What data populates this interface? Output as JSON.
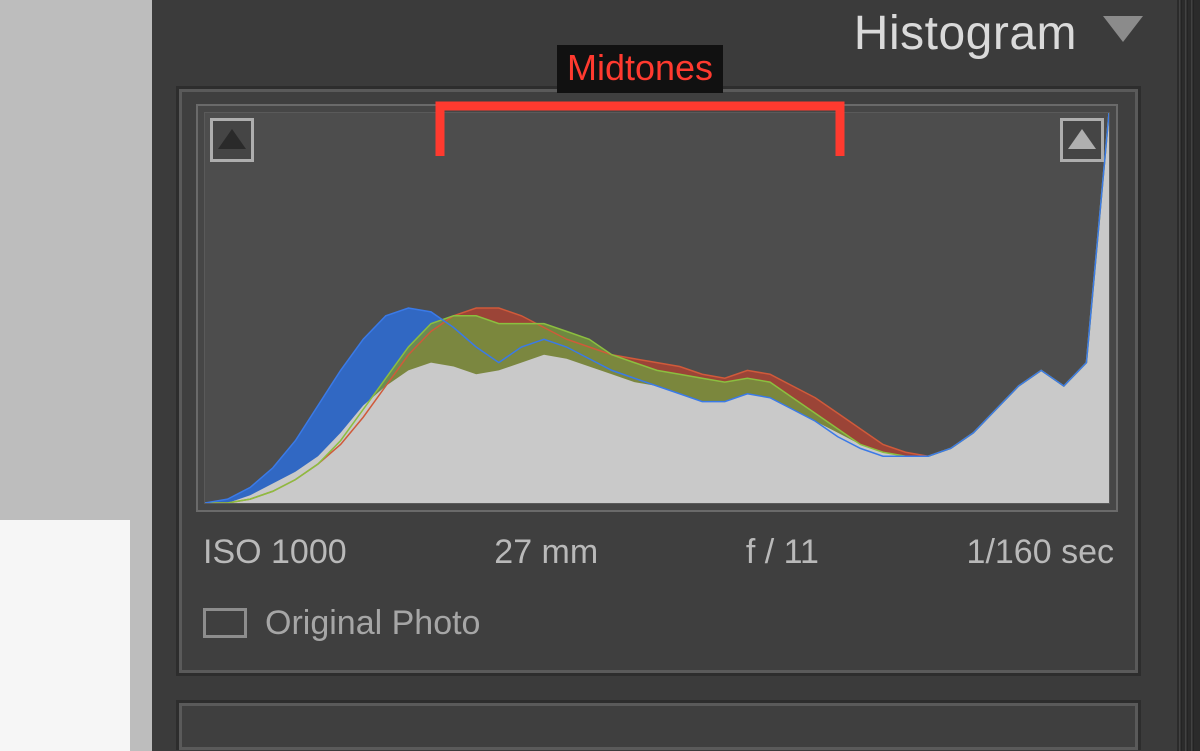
{
  "panel": {
    "title": "Histogram"
  },
  "annotation": {
    "label": "Midtones"
  },
  "meta": {
    "iso": "ISO 1000",
    "focal": "27 mm",
    "aperture": "f / 11",
    "shutter": "1/160 sec"
  },
  "original": {
    "label": "Original Photo",
    "checked": false
  },
  "clipping": {
    "shadows_enabled": false,
    "highlights_enabled": false
  },
  "chart_data": {
    "type": "area",
    "title": "Histogram",
    "xlabel": "",
    "ylabel": "",
    "xlim": [
      0,
      255
    ],
    "ylim": [
      0,
      100
    ],
    "series": [
      {
        "name": "Luminance",
        "color": "#c9c9c9",
        "values": [
          0,
          0,
          2,
          5,
          8,
          12,
          18,
          25,
          30,
          34,
          36,
          35,
          33,
          34,
          36,
          38,
          37,
          35,
          33,
          31,
          30,
          28,
          26,
          26,
          28,
          27,
          24,
          21,
          18,
          15,
          13,
          12,
          12,
          14,
          18,
          24,
          30,
          34,
          30,
          36,
          100
        ]
      },
      {
        "name": "Blue",
        "color": "#1e61c9",
        "values": [
          0,
          1,
          4,
          9,
          16,
          25,
          34,
          42,
          48,
          50,
          49,
          45,
          40,
          36,
          40,
          42,
          40,
          37,
          34,
          32,
          30,
          28,
          26,
          26,
          28,
          27,
          24,
          21,
          17,
          14,
          12,
          12,
          12,
          14,
          18,
          24,
          30,
          34,
          30,
          36,
          100
        ]
      },
      {
        "name": "Red",
        "color": "#b83b2a",
        "values": [
          0,
          0,
          1,
          3,
          6,
          10,
          15,
          22,
          30,
          38,
          44,
          48,
          50,
          50,
          48,
          45,
          42,
          40,
          38,
          37,
          36,
          35,
          33,
          32,
          34,
          33,
          30,
          27,
          23,
          19,
          15,
          13,
          12,
          14,
          18,
          24,
          30,
          34,
          30,
          36,
          100
        ]
      },
      {
        "name": "Green",
        "color": "#6f8f3d",
        "values": [
          0,
          0,
          1,
          3,
          6,
          10,
          16,
          24,
          32,
          40,
          46,
          48,
          48,
          46,
          46,
          46,
          44,
          42,
          38,
          36,
          34,
          33,
          32,
          31,
          32,
          31,
          27,
          23,
          19,
          15,
          13,
          12,
          12,
          14,
          18,
          24,
          30,
          34,
          30,
          36,
          100
        ]
      }
    ]
  }
}
